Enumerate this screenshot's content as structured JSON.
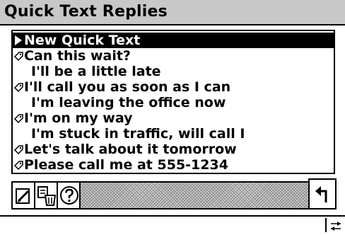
{
  "window": {
    "title": "Quick Text Replies"
  },
  "list": {
    "items": [
      {
        "label": "New Quick Text",
        "selected": true,
        "marker": "play-icon",
        "indent": false
      },
      {
        "label": "Can this wait?",
        "selected": false,
        "marker": "folder-diamond-icon",
        "indent": false
      },
      {
        "label": "I'll be a little late",
        "selected": false,
        "marker": "",
        "indent": true
      },
      {
        "label": "I'll call you as soon as I can",
        "selected": false,
        "marker": "folder-diamond-icon",
        "indent": false
      },
      {
        "label": "I'm leaving the office now",
        "selected": false,
        "marker": "",
        "indent": true
      },
      {
        "label": "I'm on my way",
        "selected": false,
        "marker": "folder-diamond-icon",
        "indent": false
      },
      {
        "label": "I'm stuck in traffic, will call I",
        "selected": false,
        "marker": "",
        "indent": true
      },
      {
        "label": "Let's talk about it tomorrow",
        "selected": false,
        "marker": "folder-diamond-icon",
        "indent": false
      },
      {
        "label": "Please call me at 555-1234",
        "selected": false,
        "marker": "folder-diamond-icon",
        "indent": false
      }
    ]
  },
  "toolbar": {
    "buttons": [
      "edit-icon",
      "copy-icon",
      "help-icon"
    ],
    "back": "back-arrow-icon"
  },
  "colors": {
    "background": "#ffffff",
    "title_bar": "#c8c8c8",
    "selection": "#000000",
    "hatch": "#8a8a8a"
  }
}
